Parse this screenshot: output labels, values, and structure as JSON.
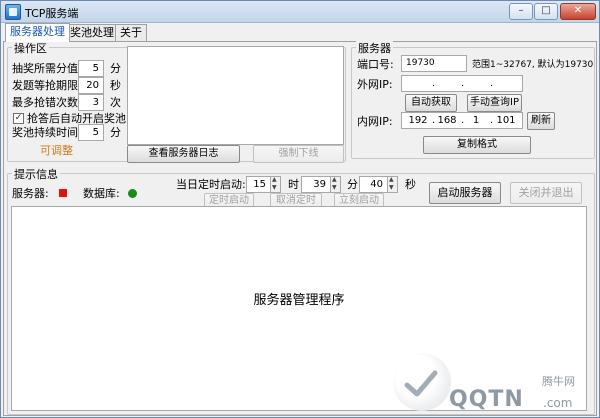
{
  "window": {
    "title": "TCP服务端",
    "controls": [
      "–",
      "□",
      "✕"
    ]
  },
  "tabs": [
    {
      "label": "服务器处理",
      "active": true
    },
    {
      "label": "奖池处理",
      "active": false
    },
    {
      "label": "关于",
      "active": false
    }
  ],
  "operations": {
    "group_title": "操作区",
    "rows": [
      {
        "label": "抽奖所需分值:",
        "value": "5",
        "unit": "分"
      },
      {
        "label": "发题等抢期限:",
        "value": "20",
        "unit": "秒"
      },
      {
        "label": "最多抢错次数:",
        "value": "3",
        "unit": "次"
      }
    ],
    "checkbox_label": "抢答后自动开启奖池",
    "checkbox_checked": true,
    "duration_label": "奖池持续时间:",
    "duration_value": "5",
    "duration_unit": "分",
    "adjustable_label": "可调整",
    "adjustable_color": "#d07a1a",
    "view_log_button": "查看服务器日志",
    "force_offline_button": "强制下线"
  },
  "server": {
    "group_title": "服务器",
    "port_label": "端口号:",
    "port_value": "19730",
    "port_hint": "范围1~32767, 默认为19730",
    "external_ip_label": "外网IP:",
    "auto_get_button": "自动获取",
    "manual_query_button": "手动查询IP",
    "internal_ip_label": "内网IP:",
    "internal_ip": [
      "192",
      "168",
      "1",
      "101"
    ],
    "refresh_button": "刷新",
    "copy_format_button": "复制格式"
  },
  "info": {
    "group_title": "提示信息",
    "server_status_label": "服务器:",
    "server_status_color": "#e31010",
    "database_status_label": "数据库:",
    "database_status_color": "#1a8a1a",
    "schedule_label": "当日定时启动:",
    "hour_value": "15",
    "hour_unit": "时",
    "minute_value": "39",
    "minute_unit": "分",
    "second_value": "40",
    "second_unit": "秒",
    "timed_start_button": "定时启动",
    "cancel_timer_button": "取消定时",
    "start_now_button": "立刻启动",
    "start_server_button": "启动服务器",
    "close_exit_button": "关闭并退出"
  },
  "console": {
    "text": "服务器管理程序"
  },
  "watermark": {
    "site_name": "腾牛网",
    "brand": "QQTN",
    "domain": ".com"
  }
}
